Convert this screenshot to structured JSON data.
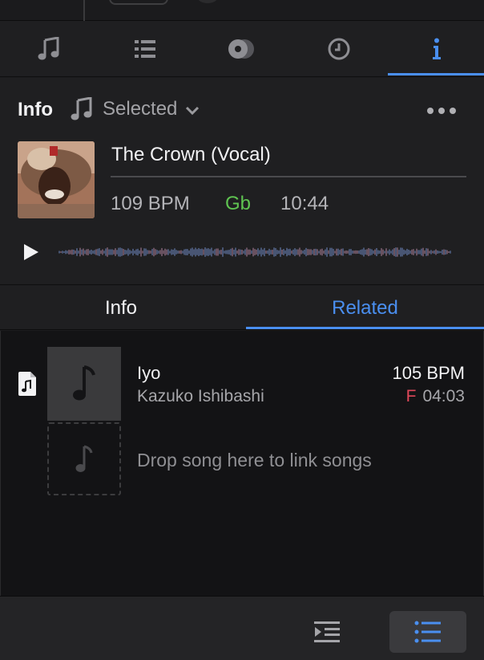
{
  "top_tabs": [
    {
      "icon": "music-note-icon",
      "active": false
    },
    {
      "icon": "list-icon",
      "active": false
    },
    {
      "icon": "vinyl-record-icon",
      "active": false
    },
    {
      "icon": "clock-icon",
      "active": false
    },
    {
      "icon": "info-icon",
      "label": "i",
      "active": true
    }
  ],
  "info": {
    "title": "Info",
    "selector_value": "Selected",
    "track": {
      "title": "The Crown (Vocal)",
      "bpm": "109 BPM",
      "key": "Gb",
      "duration": "10:44"
    }
  },
  "subtabs": {
    "info": "Info",
    "related": "Related",
    "active": "Related"
  },
  "related": {
    "items": [
      {
        "title": "Iyo",
        "artist": "Kazuko Ishibashi",
        "bpm": "105 BPM",
        "key": "F",
        "duration": "04:03"
      }
    ],
    "drop_hint": "Drop song here to link songs"
  },
  "colors": {
    "accent": "#4a8ff0",
    "key_green": "#5fc451",
    "key_red": "#e0485a",
    "background": "#1f1f21"
  }
}
